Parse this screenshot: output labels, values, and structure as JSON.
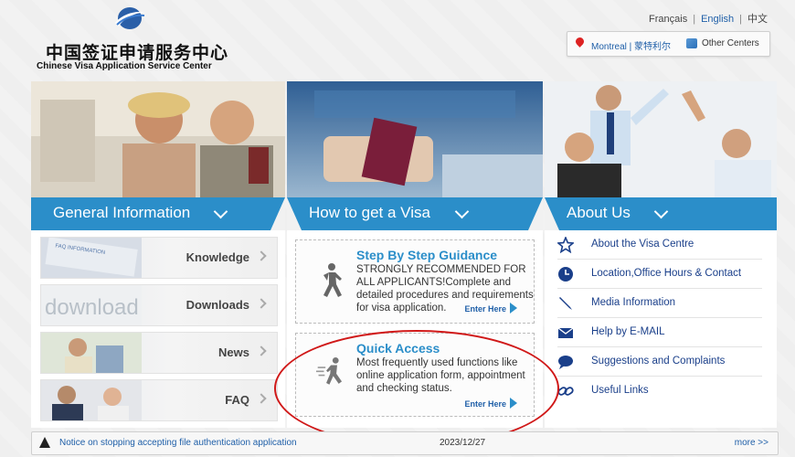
{
  "header": {
    "logo_cn": "中国签证申请服务中心",
    "logo_en": "Chinese Visa Application Service Center",
    "languages": [
      "Français",
      "English",
      "中文"
    ],
    "active_language": "English",
    "location": {
      "city": "Montreal | 蒙特利尔",
      "other_centers": "Other Centers"
    }
  },
  "columns": {
    "general": {
      "title": "General Information",
      "items": [
        {
          "label": "Knowledge",
          "thumb_text": "FAQ INFORMATION"
        },
        {
          "label": "Downloads",
          "thumb_text": "download"
        },
        {
          "label": "News"
        },
        {
          "label": "FAQ"
        }
      ]
    },
    "howto": {
      "title": "How to get a Visa",
      "guidance": {
        "title": "Step By Step Guidance",
        "desc": "STRONGLY RECOMMENDED FOR ALL APPLICANTS!Complete and detailed procedures and requirements for visa application.",
        "enter": "Enter Here"
      },
      "quick": {
        "title": "Quick Access",
        "desc": "Most frequently used functions like online application form, appointment and checking status.",
        "enter": "Enter Here"
      }
    },
    "about": {
      "title": "About Us",
      "items": [
        {
          "label": "About the Visa Centre",
          "icon": "star-icon"
        },
        {
          "label": "Location,Office Hours & Contact",
          "icon": "clock-icon"
        },
        {
          "label": "Media Information",
          "icon": "pen-icon"
        },
        {
          "label": "Help by E-MAIL",
          "icon": "mail-icon"
        },
        {
          "label": "Suggestions and Complaints",
          "icon": "chat-icon"
        },
        {
          "label": "Useful Links",
          "icon": "link-icon"
        }
      ]
    }
  },
  "footer": {
    "notice": "Notice on stopping accepting file authentication application",
    "date": "2023/12/27",
    "more": "more >>"
  },
  "colors": {
    "band": "#2b8ec9",
    "link": "#1f5fa8",
    "highlight": "#d01818"
  }
}
